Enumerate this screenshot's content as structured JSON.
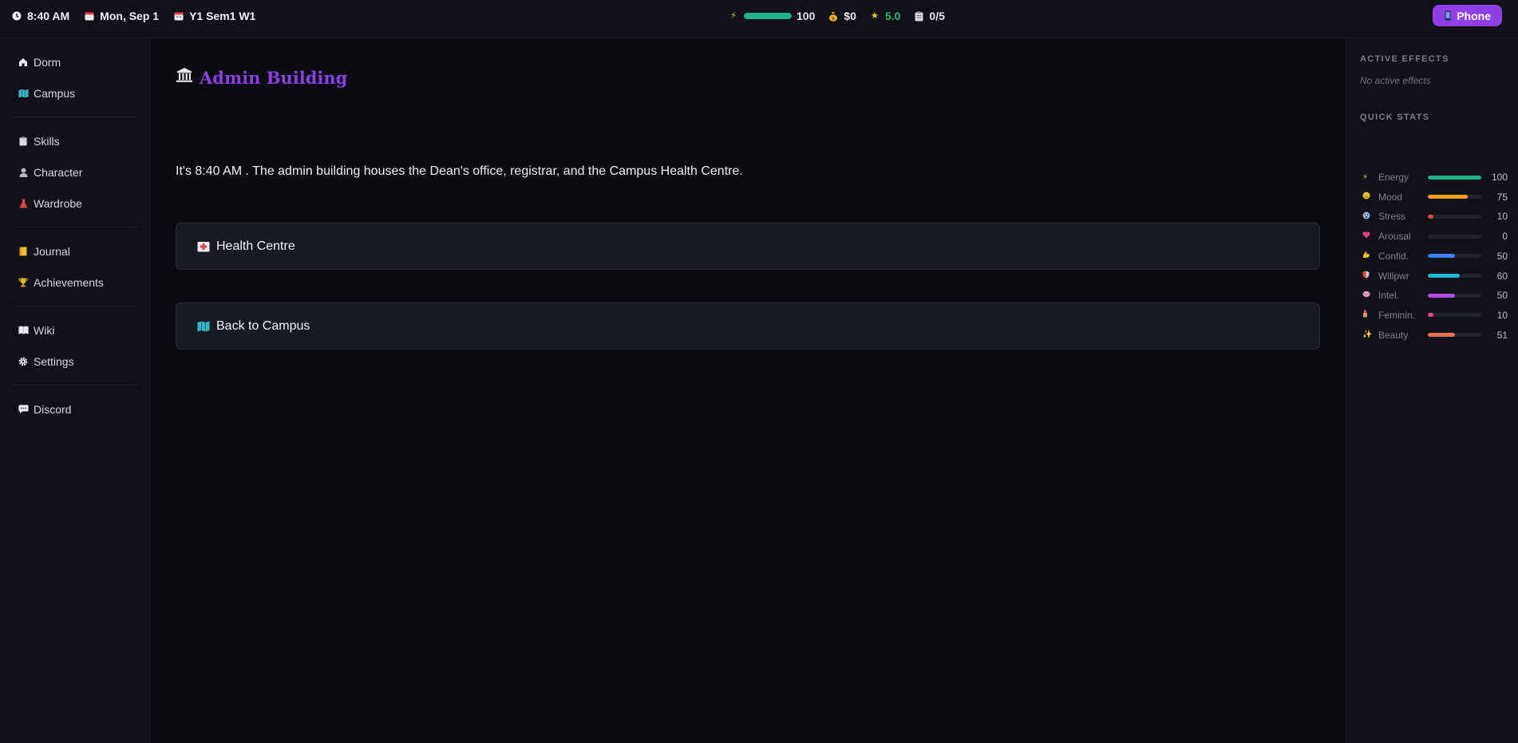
{
  "topbar": {
    "time": "8:40 AM",
    "date": "Mon, Sep 1",
    "term": "Y1 Sem1 W1",
    "energy": 100,
    "energy_label": "100",
    "money": "$0",
    "rating": "5.0",
    "tasks": "0/5",
    "phone_label": "Phone",
    "colors": {
      "energy": "#1fb383",
      "rating": "#2bb673",
      "phone": "#8e3fe6"
    }
  },
  "sidebar": {
    "groups": [
      [
        {
          "label": "Dorm",
          "icon": "house-icon"
        },
        {
          "label": "Campus",
          "icon": "map-icon"
        }
      ],
      [
        {
          "label": "Skills",
          "icon": "clipboard-icon"
        },
        {
          "label": "Character",
          "icon": "person-icon"
        },
        {
          "label": "Wardrobe",
          "icon": "dress-icon"
        }
      ],
      [
        {
          "label": "Journal",
          "icon": "notebook-icon"
        },
        {
          "label": "Achievements",
          "icon": "trophy-icon"
        }
      ],
      [
        {
          "label": "Wiki",
          "icon": "book-icon"
        },
        {
          "label": "Settings",
          "icon": "gear-icon"
        }
      ],
      [
        {
          "label": "Discord",
          "icon": "chat-icon"
        }
      ]
    ]
  },
  "main": {
    "title": "Admin Building",
    "title_icon": "bank-icon",
    "title_color": "#8b3fe4",
    "description": "It's 8:40 AM . The admin building houses the Dean's office, registrar, and the Campus Health Centre.",
    "choices": [
      {
        "label": "Health Centre",
        "icon": "hospital-icon"
      },
      {
        "label": "Back to Campus",
        "icon": "map-icon"
      }
    ]
  },
  "right_panel": {
    "active_effects_heading": "ACTIVE EFFECTS",
    "no_effects": "No active effects",
    "quick_stats_heading": "QUICK STATS",
    "stats": [
      {
        "name": "Energy",
        "value": 100,
        "label": "100",
        "color": "#1fb383",
        "icon": "lightning-icon"
      },
      {
        "name": "Mood",
        "value": 75,
        "label": "75",
        "color": "#f0a020",
        "icon": "smile-icon"
      },
      {
        "name": "Stress",
        "value": 10,
        "label": "10",
        "color": "#e04444",
        "icon": "stressed-face-icon"
      },
      {
        "name": "Arousal",
        "value": 0,
        "label": "0",
        "color": "#e04a8a",
        "icon": "heart-icon"
      },
      {
        "name": "Confid.",
        "value": 50,
        "label": "50",
        "color": "#3b82f6",
        "icon": "muscle-icon"
      },
      {
        "name": "Willpwr",
        "value": 60,
        "label": "60",
        "color": "#1fb5d6",
        "icon": "shield-icon"
      },
      {
        "name": "Intel.",
        "value": 50,
        "label": "50",
        "color": "#b24ae6",
        "icon": "brain-icon"
      },
      {
        "name": "Feminin.",
        "value": 10,
        "label": "10",
        "color": "#e04a8a",
        "icon": "lipstick-icon"
      },
      {
        "name": "Beauty",
        "value": 51,
        "label": "51",
        "color": "#f07050",
        "icon": "sparkles-icon"
      }
    ]
  }
}
